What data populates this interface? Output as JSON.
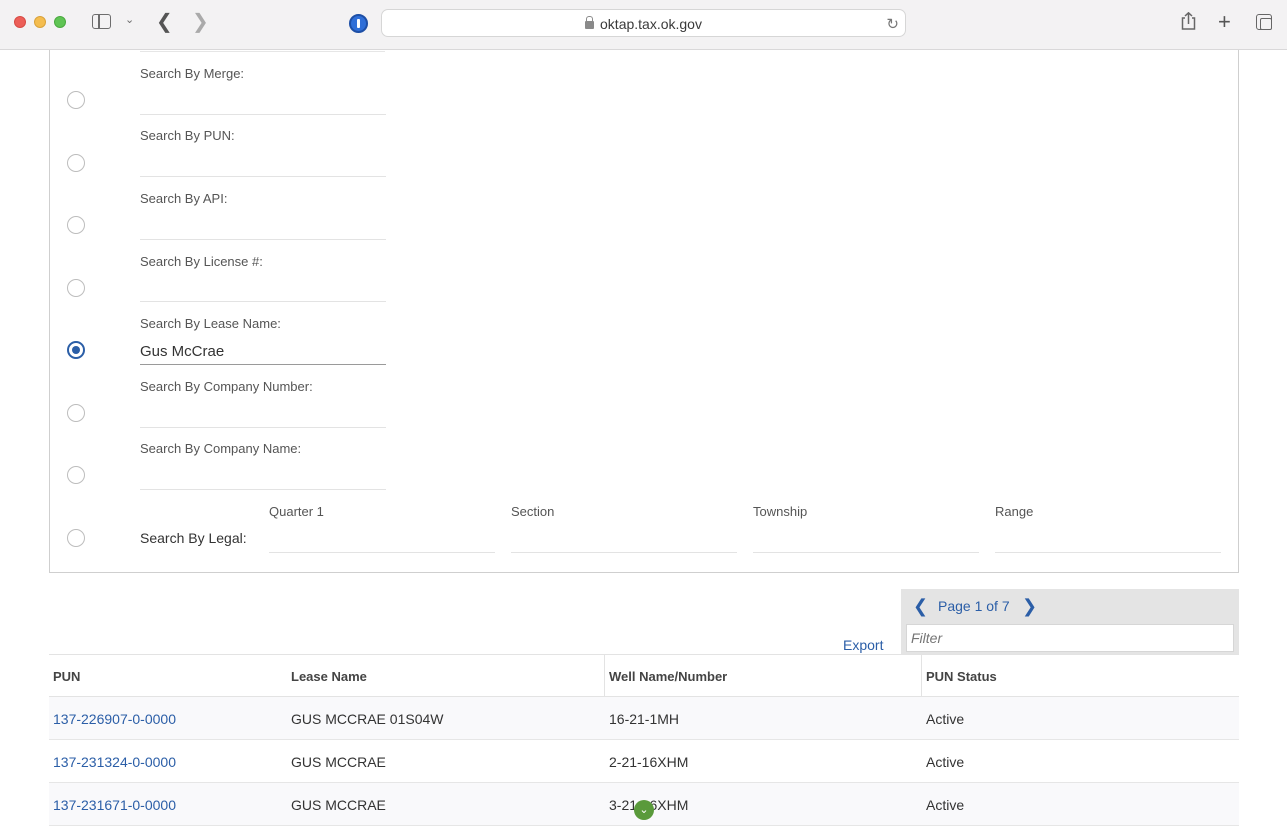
{
  "browser": {
    "url": "oktap.tax.ok.gov"
  },
  "search": {
    "fields": [
      {
        "label": "Search By Merge:",
        "value": "",
        "checked": false
      },
      {
        "label": "Search By PUN:",
        "value": "",
        "checked": false
      },
      {
        "label": "Search By API:",
        "value": "",
        "checked": false
      },
      {
        "label": "Search By License #:",
        "value": "",
        "checked": false
      },
      {
        "label": "Search By Lease Name:",
        "value": "Gus McCrae",
        "checked": true
      },
      {
        "label": "Search By Company Number:",
        "value": "",
        "checked": false
      },
      {
        "label": "Search By Company Name:",
        "value": "",
        "checked": false
      }
    ],
    "legal": {
      "label": "Search By Legal:",
      "quarter_label": "Quarter 1",
      "section_label": "Section",
      "township_label": "Township",
      "range_label": "Range"
    }
  },
  "results": {
    "pager_text": "Page 1 of 7",
    "filter_placeholder": "Filter",
    "export_label": "Export",
    "columns": [
      "PUN",
      "Lease Name",
      "Well Name/Number",
      "PUN Status"
    ],
    "rows": [
      {
        "pun": "137-226907-0-0000",
        "lease": "GUS MCCRAE 01S04W",
        "well": "16-21-1MH",
        "status": "Active"
      },
      {
        "pun": "137-231324-0-0000",
        "lease": "GUS MCCRAE",
        "well": "2-21-16XHM",
        "status": "Active"
      },
      {
        "pun": "137-231671-0-0000",
        "lease": "GUS MCCRAE",
        "well": "3-21-16XHM",
        "status": "Active"
      }
    ]
  },
  "colors": {
    "link": "#2b5ea7",
    "radio_selected": "#2b5ea7",
    "scroll_badge": "#5a9a3b"
  }
}
